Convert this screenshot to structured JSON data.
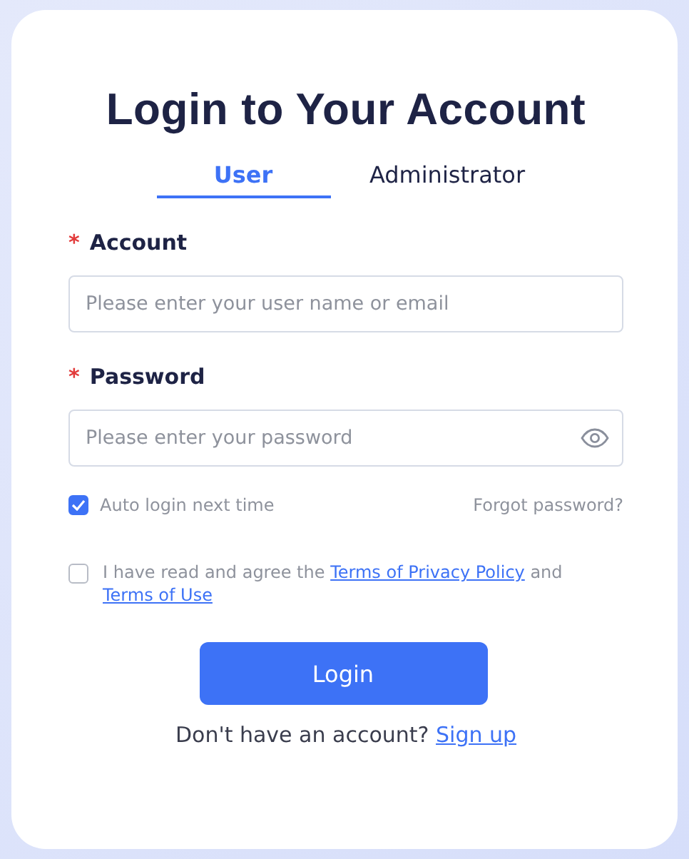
{
  "title": "Login to Your Account",
  "tabs": [
    {
      "label": "User",
      "selected": true
    },
    {
      "label": "Administrator",
      "selected": false
    }
  ],
  "fields": [
    {
      "label": "Account",
      "required_mark": "*",
      "placeholder": "Please enter your user name or email",
      "kind": "text"
    },
    {
      "label": "Password",
      "required_mark": "*",
      "placeholder": "Please enter your password",
      "kind": "password"
    }
  ],
  "auto_login": {
    "label": "Auto login next time",
    "checked": true
  },
  "forgot_link": "Forgot password?",
  "agreement": {
    "checked": false,
    "text_before": "I have read and agree the",
    "privacy_link": "Terms of Privacy Policy",
    "text_middle": "and",
    "terms_link": "Terms of Use"
  },
  "login_button": "Login",
  "signup": {
    "prompt": "Don't have an account?",
    "link": "Sign up"
  }
}
